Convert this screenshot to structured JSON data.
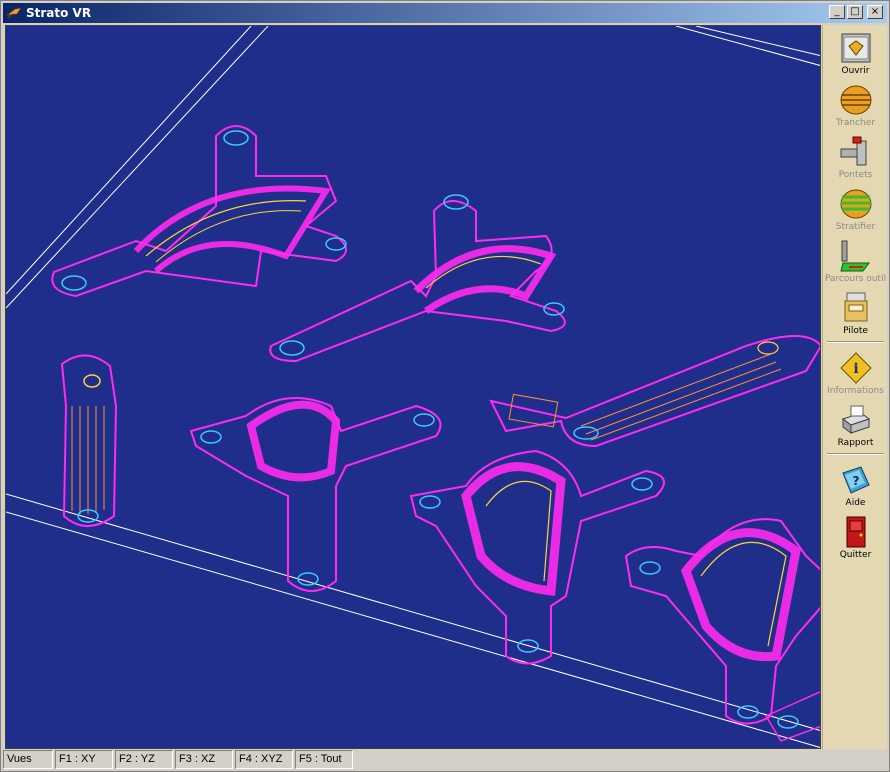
{
  "window": {
    "title": "Strato VR"
  },
  "title_buttons": {
    "minimize": "_",
    "maximize": "□",
    "close": "×"
  },
  "toolbar": {
    "items": [
      {
        "label": "Ouvrir",
        "icon": "open-icon",
        "enabled": true
      },
      {
        "label": "Trancher",
        "icon": "slice-icon",
        "enabled": false
      },
      {
        "label": "Pontets",
        "icon": "bridges-icon",
        "enabled": false
      },
      {
        "label": "Stratifier",
        "icon": "stratify-icon",
        "enabled": false
      },
      {
        "label": "Parcours outil",
        "icon": "toolpath-icon",
        "enabled": false
      },
      {
        "label": "Pilote",
        "icon": "pilot-icon",
        "enabled": true
      },
      {
        "label": "Informations",
        "icon": "info-icon",
        "enabled": false
      },
      {
        "label": "Rapport",
        "icon": "report-icon",
        "enabled": true
      },
      {
        "label": "Aide",
        "icon": "help-icon",
        "enabled": true
      },
      {
        "label": "Quitter",
        "icon": "quit-icon",
        "enabled": true
      }
    ]
  },
  "statusbar": [
    "Vues",
    "F1 : XY",
    "F2 : YZ",
    "F3 : XZ",
    "F4 : XYZ",
    "F5 : Tout"
  ],
  "colors": {
    "background": "#1f2e8a",
    "outline": "#ff2bf0",
    "contour": "#ffd23c",
    "hole": "#3cc8ff",
    "edge": "#ffffff"
  }
}
